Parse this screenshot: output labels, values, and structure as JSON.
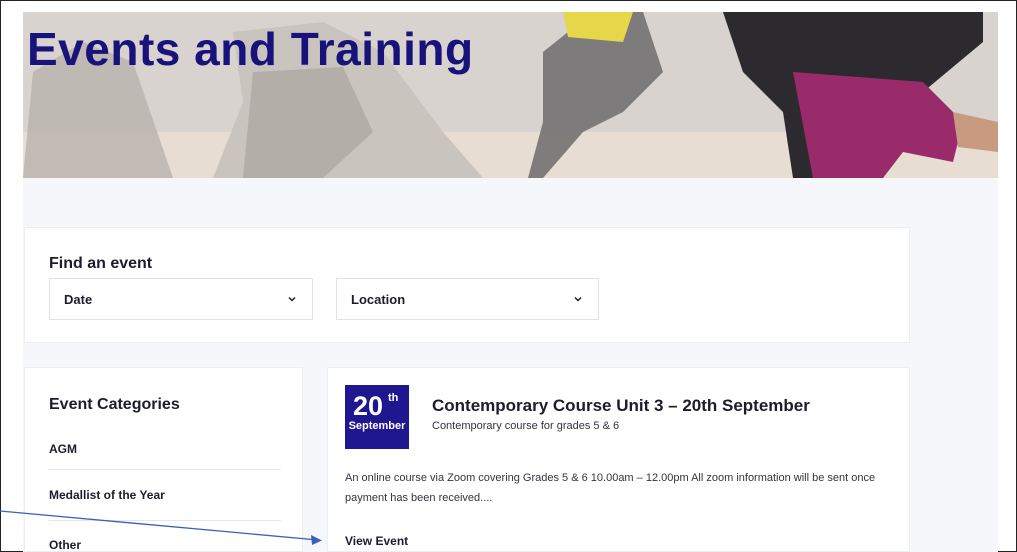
{
  "hero": {
    "title": "Events and Training"
  },
  "find_event": {
    "title": "Find an event",
    "filters": [
      {
        "label": "Date",
        "icon": "chevron-down-icon"
      },
      {
        "label": "Location",
        "icon": "chevron-down-icon"
      }
    ]
  },
  "categories": {
    "title": "Event Categories",
    "items": [
      "AGM",
      "Medallist of the Year",
      "Other"
    ]
  },
  "event": {
    "date_day": "20",
    "date_suffix": "th",
    "date_month": "September",
    "title": "Contemporary Course Unit 3 – 20th September",
    "subtitle": "Contemporary course for grades 5 & 6",
    "description": "An online course via Zoom covering Grades 5 & 6 10.00am – 12.00pm All zoom information will be sent once payment has been received....",
    "link_label": "View Event"
  },
  "colors": {
    "brand_navy": "#1e1790",
    "title_navy": "#17137a",
    "annotation_arrow": "#3d5fb5"
  }
}
